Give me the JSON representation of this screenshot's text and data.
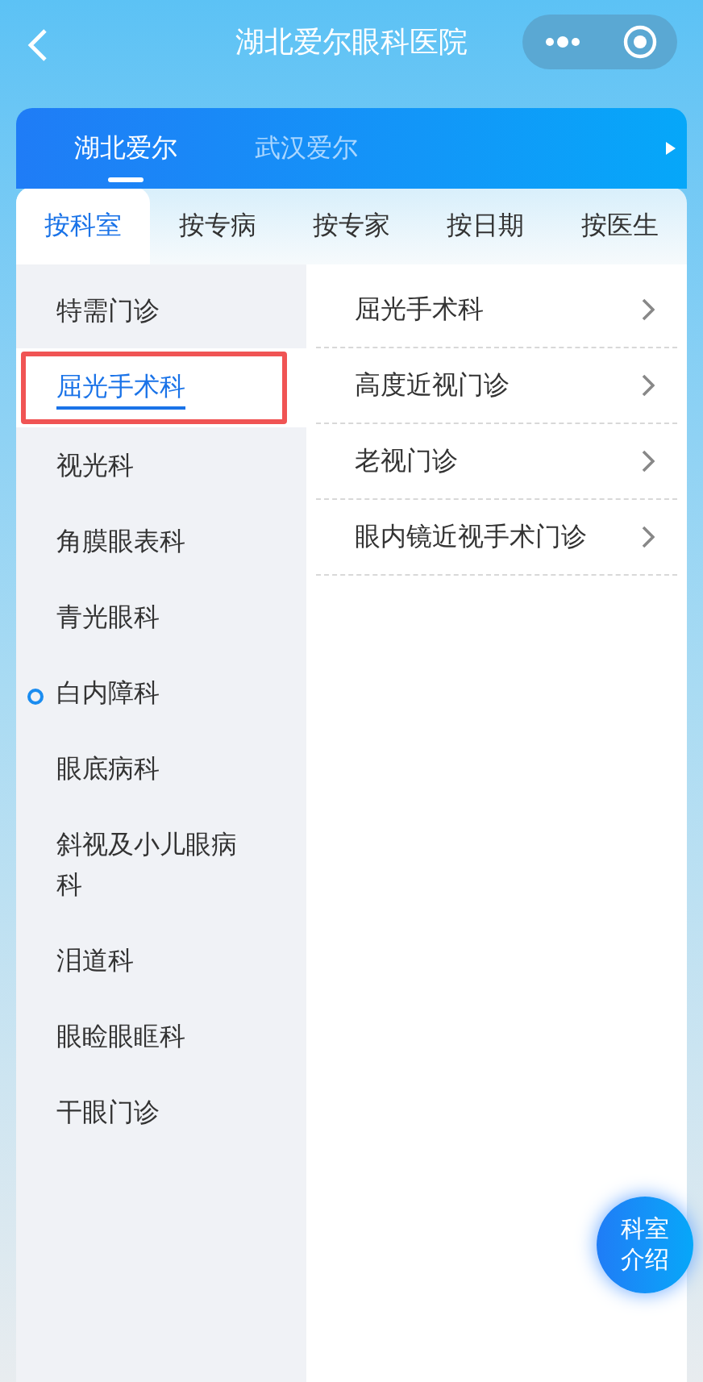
{
  "header": {
    "title": "湖北爱尔眼科医院"
  },
  "hospital_tabs": [
    {
      "label": "湖北爱尔",
      "selected": true
    },
    {
      "label": "武汉爱尔",
      "selected": false
    }
  ],
  "category_tabs": [
    {
      "label": "按科室",
      "selected": true
    },
    {
      "label": "按专病",
      "selected": false
    },
    {
      "label": "按专家",
      "selected": false
    },
    {
      "label": "按日期",
      "selected": false
    },
    {
      "label": "按医生",
      "selected": false
    }
  ],
  "departments": [
    {
      "label": "特需门诊",
      "selected": false,
      "highlighted": false,
      "marked": false
    },
    {
      "label": "屈光手术科",
      "selected": true,
      "highlighted": true,
      "marked": false
    },
    {
      "label": "视光科",
      "selected": false,
      "highlighted": false,
      "marked": false
    },
    {
      "label": "角膜眼表科",
      "selected": false,
      "highlighted": false,
      "marked": false
    },
    {
      "label": "青光眼科",
      "selected": false,
      "highlighted": false,
      "marked": false
    },
    {
      "label": "白内障科",
      "selected": false,
      "highlighted": false,
      "marked": true
    },
    {
      "label": "眼底病科",
      "selected": false,
      "highlighted": false,
      "marked": false
    },
    {
      "label": "斜视及小儿眼病科",
      "selected": false,
      "highlighted": false,
      "marked": false
    },
    {
      "label": "泪道科",
      "selected": false,
      "highlighted": false,
      "marked": false
    },
    {
      "label": "眼睑眼眶科",
      "selected": false,
      "highlighted": false,
      "marked": false
    },
    {
      "label": "干眼门诊",
      "selected": false,
      "highlighted": false,
      "marked": false
    }
  ],
  "clinics": [
    {
      "label": "屈光手术科"
    },
    {
      "label": "高度近视门诊"
    },
    {
      "label": "老视门诊"
    },
    {
      "label": "眼内镜近视手术门诊"
    }
  ],
  "float_button": {
    "line_1": "科室",
    "line_2": "介绍"
  }
}
